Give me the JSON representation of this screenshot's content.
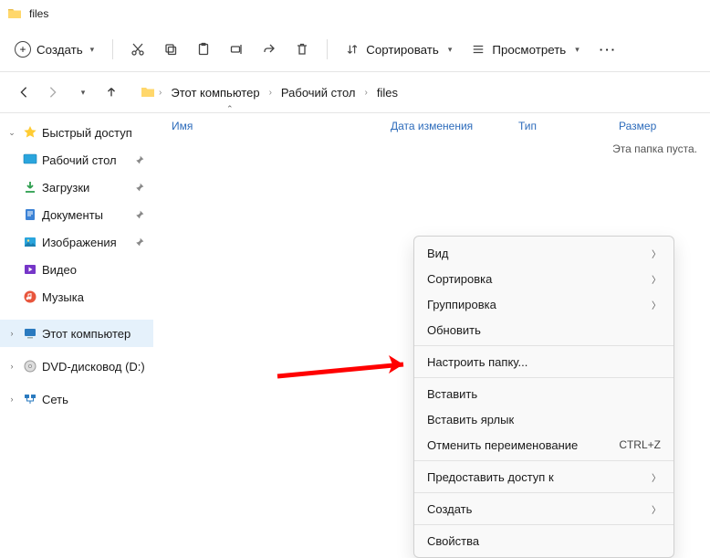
{
  "window": {
    "title": "files"
  },
  "toolbar": {
    "new_label": "Создать",
    "sort_label": "Сортировать",
    "view_label": "Просмотреть"
  },
  "breadcrumbs": [
    "Этот компьютер",
    "Рабочий стол",
    "files"
  ],
  "columns": {
    "name": "Имя",
    "date": "Дата изменения",
    "type": "Тип",
    "size": "Размер"
  },
  "empty_message": "Эта папка пуста.",
  "sidebar": {
    "quick_access": "Быстрый доступ",
    "items": [
      {
        "label": "Рабочий стол"
      },
      {
        "label": "Загрузки"
      },
      {
        "label": "Документы"
      },
      {
        "label": "Изображения"
      },
      {
        "label": "Видео"
      },
      {
        "label": "Музыка"
      }
    ],
    "this_pc": "Этот компьютер",
    "dvd": "DVD-дисковод (D:)",
    "network": "Сеть"
  },
  "context_menu": {
    "view": "Вид",
    "sort": "Сортировка",
    "group": "Группировка",
    "refresh": "Обновить",
    "customize": "Настроить папку...",
    "paste": "Вставить",
    "paste_shortcut": "Вставить ярлык",
    "undo_rename": "Отменить переименование",
    "undo_short": "CTRL+Z",
    "give_access": "Предоставить доступ к",
    "new": "Создать",
    "properties": "Свойства"
  }
}
